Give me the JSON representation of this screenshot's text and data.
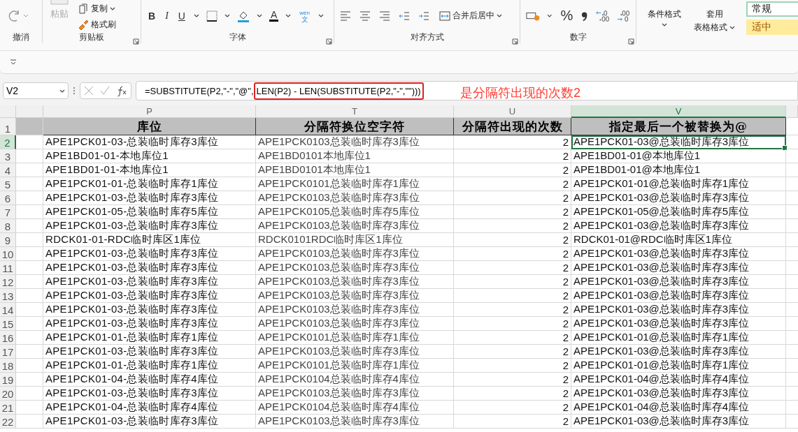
{
  "ribbon": {
    "undo_group": {
      "label": "撤消"
    },
    "clipboard_group": {
      "label": "剪贴板",
      "paste": "粘贴",
      "copy": "复制",
      "format_painter": "格式刷"
    },
    "font_group": {
      "label": "字体",
      "bold": "B",
      "italic": "I",
      "underline": "U",
      "font_color": "A",
      "phonetic_top": "wén",
      "phonetic_bottom": "文"
    },
    "alignment_group": {
      "label": "对齐方式",
      "merge": "合并后居中"
    },
    "number_group": {
      "label": "数字",
      "percent": "%"
    },
    "styles_group": {
      "conditional_format": "条件格式",
      "table_format_top": "套用",
      "table_format_bottom": "表格格式",
      "style_normal": "常规",
      "style_neutral": "适中"
    }
  },
  "name_box": "V2",
  "formula": {
    "prefix": "=SUBSTITUTE(P2,\"-\",\"@\",",
    "highlighted": "LEN(P2) - LEN(SUBSTITUTE(P2,\"-\",\"\")))"
  },
  "annotation": "是分隔符出现的次数2",
  "columns": [
    {
      "letter": "P",
      "selected": false
    },
    {
      "letter": "T",
      "selected": false
    },
    {
      "letter": "U",
      "selected": false
    },
    {
      "letter": "V",
      "selected": true
    }
  ],
  "header_row": {
    "number": "1",
    "cells": [
      "库位",
      "分隔符换位空字符",
      "分隔符出现的次数",
      "指定最后一个被替换为@"
    ]
  },
  "rows": [
    {
      "number": "2",
      "selected": true,
      "cells": [
        "APE1PCK01-03-总装临时库存3库位",
        "APE1PCK0103总装临时库存3库位",
        "2",
        "APE1PCK01-03@总装临时库存3库位"
      ]
    },
    {
      "number": "3",
      "selected": false,
      "cells": [
        "APE1BD01-01-本地库位1",
        "APE1BD0101本地库位1",
        "2",
        "APE1BD01-01@本地库位1"
      ]
    },
    {
      "number": "4",
      "selected": false,
      "cells": [
        "APE1BD01-01-本地库位1",
        "APE1BD0101本地库位1",
        "2",
        "APE1BD01-01@本地库位1"
      ]
    },
    {
      "number": "5",
      "selected": false,
      "cells": [
        "APE1PCK01-01-总装临时库存1库位",
        "APE1PCK0101总装临时库存1库位",
        "2",
        "APE1PCK01-01@总装临时库存1库位"
      ]
    },
    {
      "number": "6",
      "selected": false,
      "cells": [
        "APE1PCK01-03-总装临时库存3库位",
        "APE1PCK0103总装临时库存3库位",
        "2",
        "APE1PCK01-03@总装临时库存3库位"
      ]
    },
    {
      "number": "7",
      "selected": false,
      "cells": [
        "APE1PCK01-05-总装临时库存5库位",
        "APE1PCK0105总装临时库存5库位",
        "2",
        "APE1PCK01-05@总装临时库存5库位"
      ]
    },
    {
      "number": "8",
      "selected": false,
      "cells": [
        "APE1PCK01-03-总装临时库存3库位",
        "APE1PCK0103总装临时库存3库位",
        "2",
        "APE1PCK01-03@总装临时库存3库位"
      ]
    },
    {
      "number": "9",
      "selected": false,
      "cells": [
        "RDCK01-01-RDC临时库区1库位",
        "RDCK0101RDC临时库区1库位",
        "2",
        "RDCK01-01@RDC临时库区1库位"
      ]
    },
    {
      "number": "10",
      "selected": false,
      "cells": [
        "APE1PCK01-03-总装临时库存3库位",
        "APE1PCK0103总装临时库存3库位",
        "2",
        "APE1PCK01-03@总装临时库存3库位"
      ]
    },
    {
      "number": "11",
      "selected": false,
      "cells": [
        "APE1PCK01-03-总装临时库存3库位",
        "APE1PCK0103总装临时库存3库位",
        "2",
        "APE1PCK01-03@总装临时库存3库位"
      ]
    },
    {
      "number": "12",
      "selected": false,
      "cells": [
        "APE1PCK01-03-总装临时库存3库位",
        "APE1PCK0103总装临时库存3库位",
        "2",
        "APE1PCK01-03@总装临时库存3库位"
      ]
    },
    {
      "number": "13",
      "selected": false,
      "cells": [
        "APE1PCK01-03-总装临时库存3库位",
        "APE1PCK0103总装临时库存3库位",
        "2",
        "APE1PCK01-03@总装临时库存3库位"
      ]
    },
    {
      "number": "14",
      "selected": false,
      "cells": [
        "APE1PCK01-03-总装临时库存3库位",
        "APE1PCK0103总装临时库存3库位",
        "2",
        "APE1PCK01-03@总装临时库存3库位"
      ]
    },
    {
      "number": "15",
      "selected": false,
      "cells": [
        "APE1PCK01-03-总装临时库存3库位",
        "APE1PCK0103总装临时库存3库位",
        "2",
        "APE1PCK01-03@总装临时库存3库位"
      ]
    },
    {
      "number": "16",
      "selected": false,
      "cells": [
        "APE1PCK01-01-总装临时库存1库位",
        "APE1PCK0101总装临时库存1库位",
        "2",
        "APE1PCK01-01@总装临时库存1库位"
      ]
    },
    {
      "number": "17",
      "selected": false,
      "cells": [
        "APE1PCK01-03-总装临时库存3库位",
        "APE1PCK0103总装临时库存3库位",
        "2",
        "APE1PCK01-03@总装临时库存3库位"
      ]
    },
    {
      "number": "18",
      "selected": false,
      "cells": [
        "APE1PCK01-01-总装临时库存1库位",
        "APE1PCK0101总装临时库存1库位",
        "2",
        "APE1PCK01-01@总装临时库存1库位"
      ]
    },
    {
      "number": "19",
      "selected": false,
      "cells": [
        "APE1PCK01-04-总装临时库存4库位",
        "APE1PCK0104总装临时库存4库位",
        "2",
        "APE1PCK01-04@总装临时库存4库位"
      ]
    },
    {
      "number": "20",
      "selected": false,
      "cells": [
        "APE1PCK01-03-总装临时库存3库位",
        "APE1PCK0103总装临时库存3库位",
        "2",
        "APE1PCK01-03@总装临时库存3库位"
      ]
    },
    {
      "number": "21",
      "selected": false,
      "cells": [
        "APE1PCK01-04-总装临时库存4库位",
        "APE1PCK0104总装临时库存4库位",
        "2",
        "APE1PCK01-04@总装临时库存4库位"
      ]
    },
    {
      "number": "22",
      "selected": false,
      "cells": [
        "APE1PCK01-03-总装临时库存3库位",
        "APE1PCK0103总装临时库存3库位",
        "2",
        "APE1PCK01-03@总装临时库存3库位"
      ]
    }
  ]
}
